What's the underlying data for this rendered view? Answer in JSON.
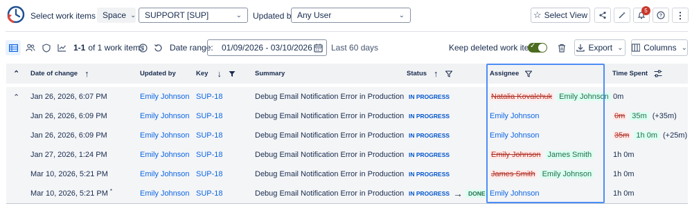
{
  "toolbar": {
    "select_label": "Select work items by:",
    "space_button": "Space",
    "project_value": "SUPPORT [SUP]",
    "updated_by_label": "Updated by:",
    "updated_by_value": "Any User",
    "select_view_label": "Select View",
    "notification_count": "5"
  },
  "toolbar2": {
    "count_bold": "1-1",
    "count_rest": "of 1 work items",
    "date_range_label": "Date range:",
    "date_range_value": "01/09/2026 - 03/10/2026",
    "date_hint": "Last 60 days",
    "keep_deleted_label": "Keep deleted work items",
    "keep_deleted_on": true,
    "export_label": "Export",
    "columns_label": "Columns"
  },
  "colors": {
    "accent": "#0c66e4",
    "highlight": "#4c8df6",
    "toggle": "#4b6b1f",
    "badge": "#c9372c"
  },
  "table": {
    "headers": {
      "date": "Date of change",
      "updated_by": "Updated by",
      "key": "Key",
      "summary": "Summary",
      "status": "Status",
      "assignee": "Assignee",
      "time_spent": "Time Spent"
    },
    "rows": [
      {
        "date": "Jan 26, 2026, 6:07 PM",
        "updated_by": "Emily Johnson",
        "key": "SUP-18",
        "summary": "Debug Email Notification Error in Production",
        "status": "IN PROGRESS",
        "status_to": "",
        "assignee_old": "Natalia Kovalchuk",
        "assignee_new": "Emily Johnson",
        "assignee": "",
        "time_old": "",
        "time_new": "",
        "time_plain": "0m",
        "time_delta": ""
      },
      {
        "date": "Jan 26, 2026, 6:09 PM",
        "updated_by": "Emily Johnson",
        "key": "SUP-18",
        "summary": "Debug Email Notification Error in Production",
        "status": "IN PROGRESS",
        "status_to": "",
        "assignee_old": "",
        "assignee_new": "",
        "assignee": "Emily Johnson",
        "time_old": "0m",
        "time_new": "35m",
        "time_plain": "",
        "time_delta": "(+35m)"
      },
      {
        "date": "Jan 26, 2026, 6:09 PM",
        "updated_by": "Emily Johnson",
        "key": "SUP-18",
        "summary": "Debug Email Notification Error in Production",
        "status": "IN PROGRESS",
        "status_to": "",
        "assignee_old": "",
        "assignee_new": "",
        "assignee": "Emily Johnson",
        "time_old": "35m",
        "time_new": "1h 0m",
        "time_plain": "",
        "time_delta": "(+25m)"
      },
      {
        "date": "Jan 27, 2026, 1:24 PM",
        "updated_by": "Emily Johnson",
        "key": "SUP-18",
        "summary": "Debug Email Notification Error in Production",
        "status": "IN PROGRESS",
        "status_to": "",
        "assignee_old": "Emily Johnson",
        "assignee_new": "James Smith",
        "assignee": "",
        "time_old": "",
        "time_new": "",
        "time_plain": "1h 0m",
        "time_delta": ""
      },
      {
        "date": "Mar 10, 2026, 5:21 PM",
        "updated_by": "Emily Johnson",
        "key": "SUP-18",
        "summary": "Debug Email Notification Error in Production",
        "status": "IN PROGRESS",
        "status_to": "",
        "assignee_old": "James Smith",
        "assignee_new": "Emily Johnson",
        "assignee": "",
        "time_old": "",
        "time_new": "",
        "time_plain": "1h 0m",
        "time_delta": ""
      },
      {
        "date": "Mar 10, 2026, 5:21 PM",
        "date_marker": "*",
        "updated_by": "Emily Johnson",
        "key": "SUP-18",
        "summary": "Debug Email Notification Error in Production",
        "status": "IN PROGRESS",
        "status_to": "DONE",
        "assignee_old": "",
        "assignee_new": "",
        "assignee": "Emily Johnson",
        "time_old": "",
        "time_new": "",
        "time_plain": "1h 0m",
        "time_delta": ""
      }
    ]
  }
}
